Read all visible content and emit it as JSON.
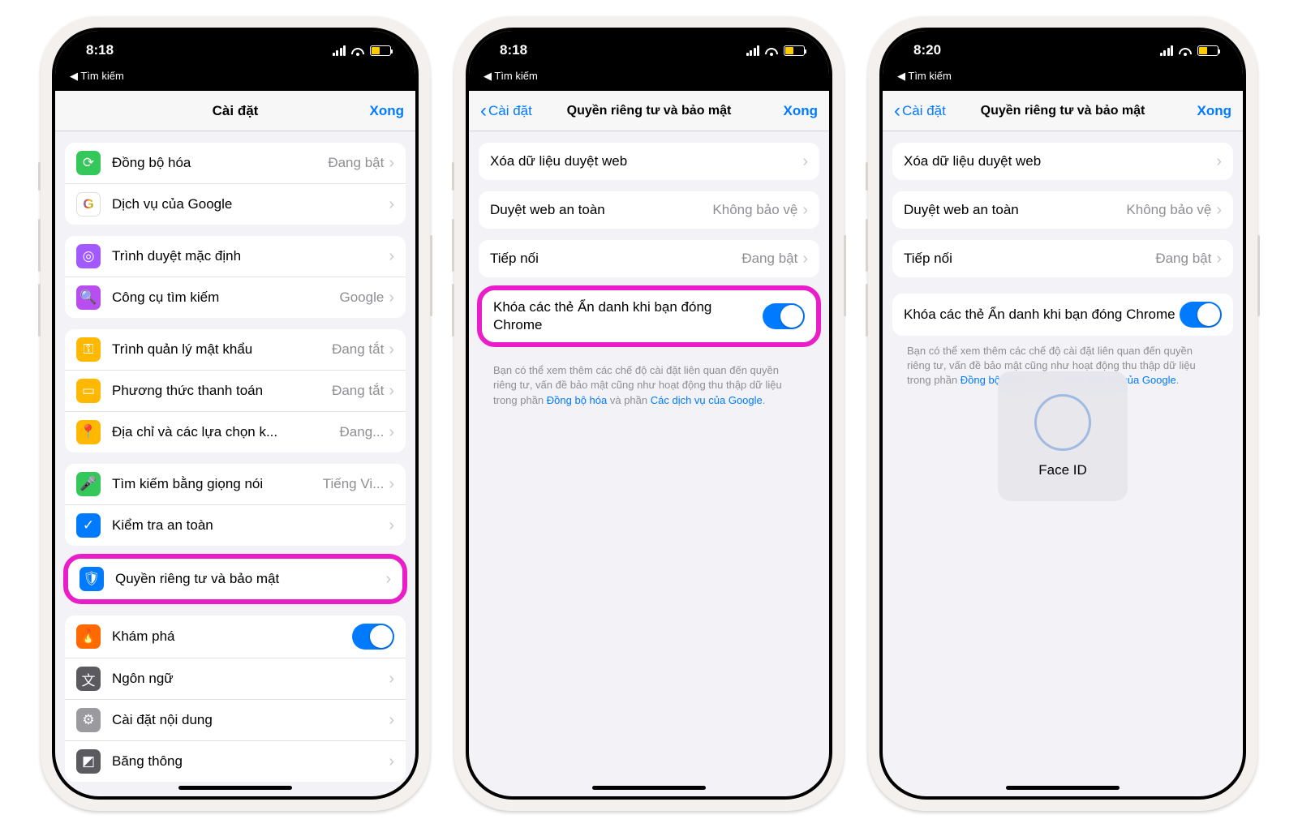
{
  "phone1": {
    "time": "8:18",
    "breadcrumb": "◀ Tìm kiếm",
    "header_title": "Cài đặt",
    "done": "Xong",
    "rows": {
      "sync": {
        "label": "Đồng bộ hóa",
        "value": "Đang bật"
      },
      "google": {
        "label": "Dịch vụ của Google"
      },
      "browser": {
        "label": "Trình duyệt mặc định"
      },
      "search": {
        "label": "Công cụ tìm kiếm",
        "value": "Google"
      },
      "pwd": {
        "label": "Trình quản lý mật khẩu",
        "value": "Đang tắt"
      },
      "pay": {
        "label": "Phương thức thanh toán",
        "value": "Đang tắt"
      },
      "addr": {
        "label": "Địa chỉ và các lựa chọn k...",
        "value": "Đang..."
      },
      "voice": {
        "label": "Tìm kiếm bằng giọng nói",
        "value": "Tiếng Vi..."
      },
      "safe": {
        "label": "Kiểm tra an toàn"
      },
      "privacy": {
        "label": "Quyền riêng tư và bảo mật"
      },
      "discover": {
        "label": "Khám phá"
      },
      "lang": {
        "label": "Ngôn ngữ"
      },
      "content": {
        "label": "Cài đặt nội dung"
      },
      "band": {
        "label": "Băng thông"
      }
    }
  },
  "phone2": {
    "time": "8:18",
    "breadcrumb": "◀ Tìm kiếm",
    "back": "Cài đặt",
    "title": "Quyền riêng tư và bảo mật",
    "done": "Xong",
    "rows": {
      "clear": {
        "label": "Xóa dữ liệu duyệt web"
      },
      "safeb": {
        "label": "Duyệt web an toàn",
        "value": "Không bảo vệ"
      },
      "hand": {
        "label": "Tiếp nối",
        "value": "Đang bật"
      },
      "lock": {
        "label": "Khóa các thẻ Ẩn danh khi bạn đóng Chrome"
      }
    },
    "footer": {
      "pre": "Bạn có thể xem thêm các chế độ cài đặt liên quan đến quyền riêng tư, vấn đề bảo mật cũng như hoạt động thu thập dữ liệu trong phần ",
      "l1": "Đồng bộ hóa",
      "mid": " và phần ",
      "l2": "Các dịch vụ của Google",
      "post": "."
    }
  },
  "phone3": {
    "time": "8:20",
    "faceid": "Face ID"
  }
}
